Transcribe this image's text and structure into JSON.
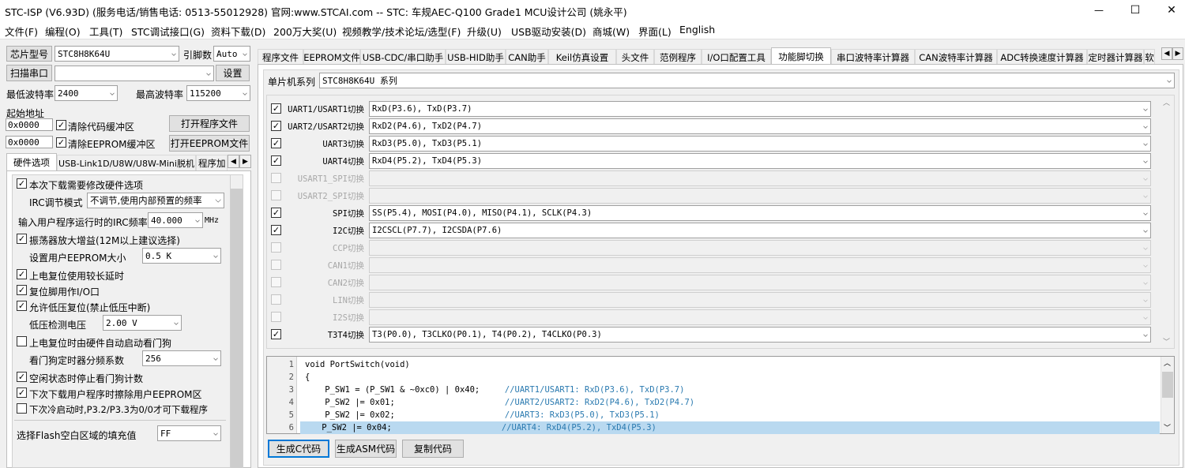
{
  "window": {
    "title": "STC-ISP (V6.93D) (服务电话/销售电话: 0513-55012928) 官网:www.STCAI.com  -- STC: 车规AEC-Q100 Grade1 MCU设计公司 (姚永平)",
    "minimize": "—",
    "maximize": "☐",
    "close": "✕"
  },
  "menu": [
    "文件(F)",
    "编程(O)",
    "工具(T)",
    "STC调试接口(G)",
    "资料下载(D)",
    "200万大奖(U)",
    "视频教学/技术论坛/选型(F)",
    "升级(U)",
    "USB驱动安装(D)",
    "商城(W)",
    "界面(L)",
    "English"
  ],
  "left": {
    "chip_label": "芯片型号",
    "chip_value": "STC8H8K64U",
    "pins_label": "引脚数",
    "pins_value": "Auto",
    "scan_button": "扫描串口",
    "port_value": "",
    "settings_button": "设置",
    "min_baud_label": "最低波特率",
    "min_baud_value": "2400",
    "max_baud_label": "最高波特率",
    "max_baud_value": "115200",
    "start_addr_label": "起始地址",
    "addr1": "0x0000",
    "clear_code_label": "清除代码缓冲区",
    "open_prog_button": "打开程序文件",
    "addr2": "0x0000",
    "clear_eeprom_label": "清除EEPROM缓冲区",
    "open_eeprom_button": "打开EEPROM文件",
    "tabs": [
      "硬件选项",
      "USB-Link1D/U8W/U8W-Mini脱机",
      "程序加"
    ],
    "hw": {
      "opt_modify": "本次下载需要修改硬件选项",
      "irc_mode_label": "IRC调节模式",
      "irc_mode_value": "不调节,使用内部预置的频率",
      "irc_freq_label": "输入用户程序运行时的IRC频率",
      "irc_freq_value": "40.000",
      "irc_unit": "MHz",
      "osc_gain": "振荡器放大增益(12M以上建议选择)",
      "eeprom_size_label": "设置用户EEPROM大小",
      "eeprom_size_value": "0.5 K",
      "long_delay": "上电复位使用较长延时",
      "reset_io": "复位脚用作I/O口",
      "lvr": "允许低压复位(禁止低压中断)",
      "lvd_label": "低压检测电压",
      "lvd_value": "2.00 V",
      "wdt_auto": "上电复位时由硬件自动启动看门狗",
      "wdt_div_label": "看门狗定时器分频系数",
      "wdt_div_value": "256",
      "idle_wdt": "空闲状态时停止看门狗计数",
      "erase_eeprom": "下次下载用户程序时擦除用户EEPROM区",
      "cold_boot": "下次冷启动时,P3.2/P3.3为0/0才可下载程序",
      "flash_fill_label": "选择Flash空白区域的填充值",
      "flash_fill_value": "FF"
    }
  },
  "right": {
    "tabs": [
      "程序文件",
      "EEPROM文件",
      "USB-CDC/串口助手",
      "USB-HID助手",
      "CAN助手",
      "Keil仿真设置",
      "头文件",
      "范例程序",
      "I/O口配置工具",
      "功能脚切换",
      "串口波特率计算器",
      "CAN波特率计算器",
      "ADC转换速度计算器",
      "定时器计算器",
      "软"
    ],
    "series_label": "单片机系列",
    "series_value": "STC8H8K64U 系列",
    "rows": [
      {
        "label": "UART1/USART1切换",
        "value": "RxD(P3.6), TxD(P3.7)",
        "checked": true,
        "enabled": true
      },
      {
        "label": "UART2/USART2切换",
        "value": "RxD2(P4.6), TxD2(P4.7)",
        "checked": true,
        "enabled": true
      },
      {
        "label": "UART3切换",
        "value": "RxD3(P5.0), TxD3(P5.1)",
        "checked": true,
        "enabled": true
      },
      {
        "label": "UART4切换",
        "value": "RxD4(P5.2), TxD4(P5.3)",
        "checked": true,
        "enabled": true
      },
      {
        "label": "USART1_SPI切换",
        "value": "",
        "checked": false,
        "enabled": false
      },
      {
        "label": "USART2_SPI切换",
        "value": "",
        "checked": false,
        "enabled": false
      },
      {
        "label": "SPI切换",
        "value": "SS(P5.4), MOSI(P4.0), MISO(P4.1), SCLK(P4.3)",
        "checked": true,
        "enabled": true
      },
      {
        "label": "I2C切换",
        "value": "I2CSCL(P7.7), I2CSDA(P7.6)",
        "checked": true,
        "enabled": true
      },
      {
        "label": "CCP切换",
        "value": "",
        "checked": false,
        "enabled": false
      },
      {
        "label": "CAN1切换",
        "value": "",
        "checked": false,
        "enabled": false
      },
      {
        "label": "CAN2切换",
        "value": "",
        "checked": false,
        "enabled": false
      },
      {
        "label": "LIN切换",
        "value": "",
        "checked": false,
        "enabled": false
      },
      {
        "label": "I2S切换",
        "value": "",
        "checked": false,
        "enabled": false
      },
      {
        "label": "T3T4切换",
        "value": "T3(P0.0), T3CLKO(P0.1), T4(P0.2), T4CLKO(P0.3)",
        "checked": true,
        "enabled": true
      }
    ],
    "code": [
      {
        "n": "1",
        "code": "void PortSwitch(void)",
        "comment": ""
      },
      {
        "n": "2",
        "code": "{",
        "comment": ""
      },
      {
        "n": "3",
        "code": "    P_SW1 = (P_SW1 & ~0xc0) | 0x40;     ",
        "comment": "//UART1/USART1: RxD(P3.6), TxD(P3.7)"
      },
      {
        "n": "4",
        "code": "    P_SW2 |= 0x01;                      ",
        "comment": "//UART2/USART2: RxD2(P4.6), TxD2(P4.7)"
      },
      {
        "n": "5",
        "code": "    P_SW2 |= 0x02;                      ",
        "comment": "//UART3: RxD3(P5.0), TxD3(P5.1)"
      },
      {
        "n": "6",
        "code": "    P_SW2 |= 0x04;                      ",
        "comment": "//UART4: RxD4(P5.2), TxD4(P5.3)"
      }
    ],
    "gen_c_button": "生成C代码",
    "gen_asm_button": "生成ASM代码",
    "copy_button": "复制代码"
  },
  "colors": {
    "highlight": "#b9d9f0",
    "comment": "#2a7ab0"
  }
}
